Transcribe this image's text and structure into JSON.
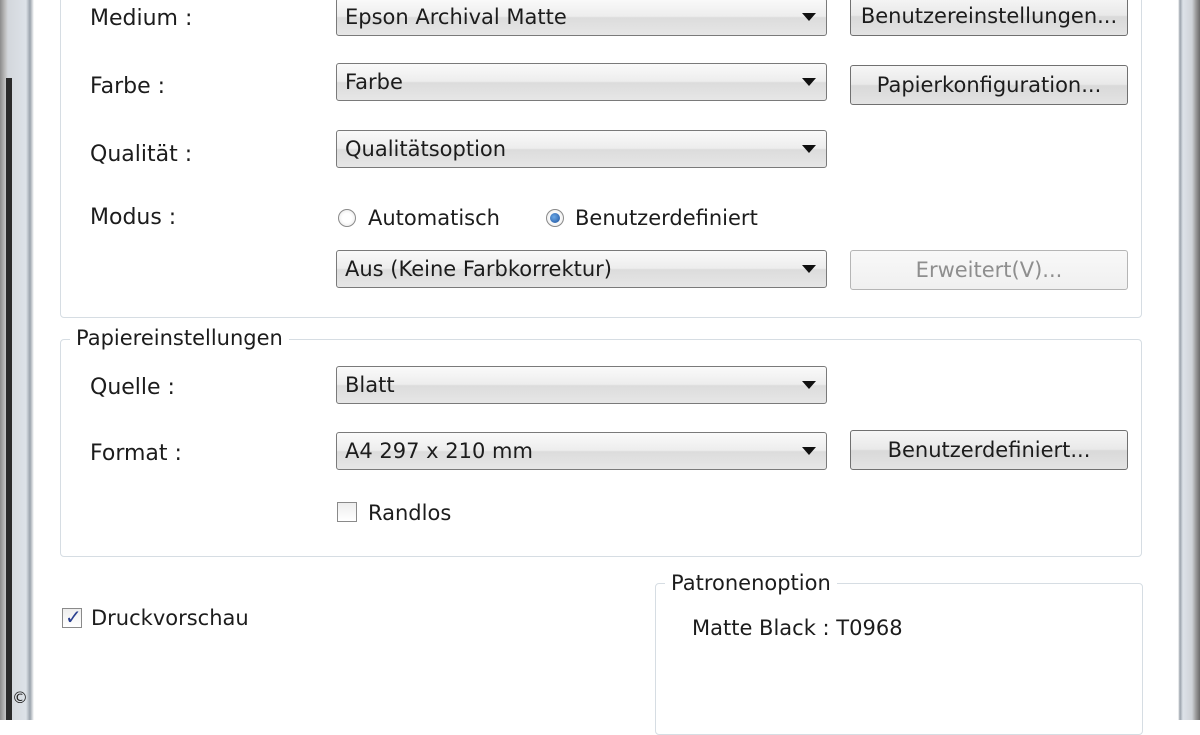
{
  "print_settings": {
    "medium": {
      "label": "Medium :",
      "value": "Epson Archival Matte",
      "button": "Benutzereinstellungen..."
    },
    "color": {
      "label": "Farbe :",
      "value": "Farbe",
      "button": "Papierkonfiguration..."
    },
    "quality": {
      "label": "Qualität :",
      "value": "Qualitätsoption"
    },
    "mode": {
      "label": "Modus :",
      "options": [
        "Automatisch",
        "Benutzerdefiniert"
      ],
      "selected": "Benutzerdefiniert",
      "correction_value": "Aus (Keine Farbkorrektur)",
      "advanced_button": "Erweitert(V)..."
    }
  },
  "paper_settings": {
    "title": "Papiereinstellungen",
    "source": {
      "label": "Quelle :",
      "value": "Blatt"
    },
    "format": {
      "label": "Format :",
      "value": "A4 297 x 210 mm",
      "button": "Benutzerdefiniert..."
    },
    "borderless": {
      "label": "Randlos",
      "checked": false
    }
  },
  "preview": {
    "label": "Druckvorschau",
    "checked": true
  },
  "cartridge": {
    "title": "Patronenoption",
    "value": "Matte Black : T0968"
  },
  "footer": {
    "copyright": "©"
  }
}
